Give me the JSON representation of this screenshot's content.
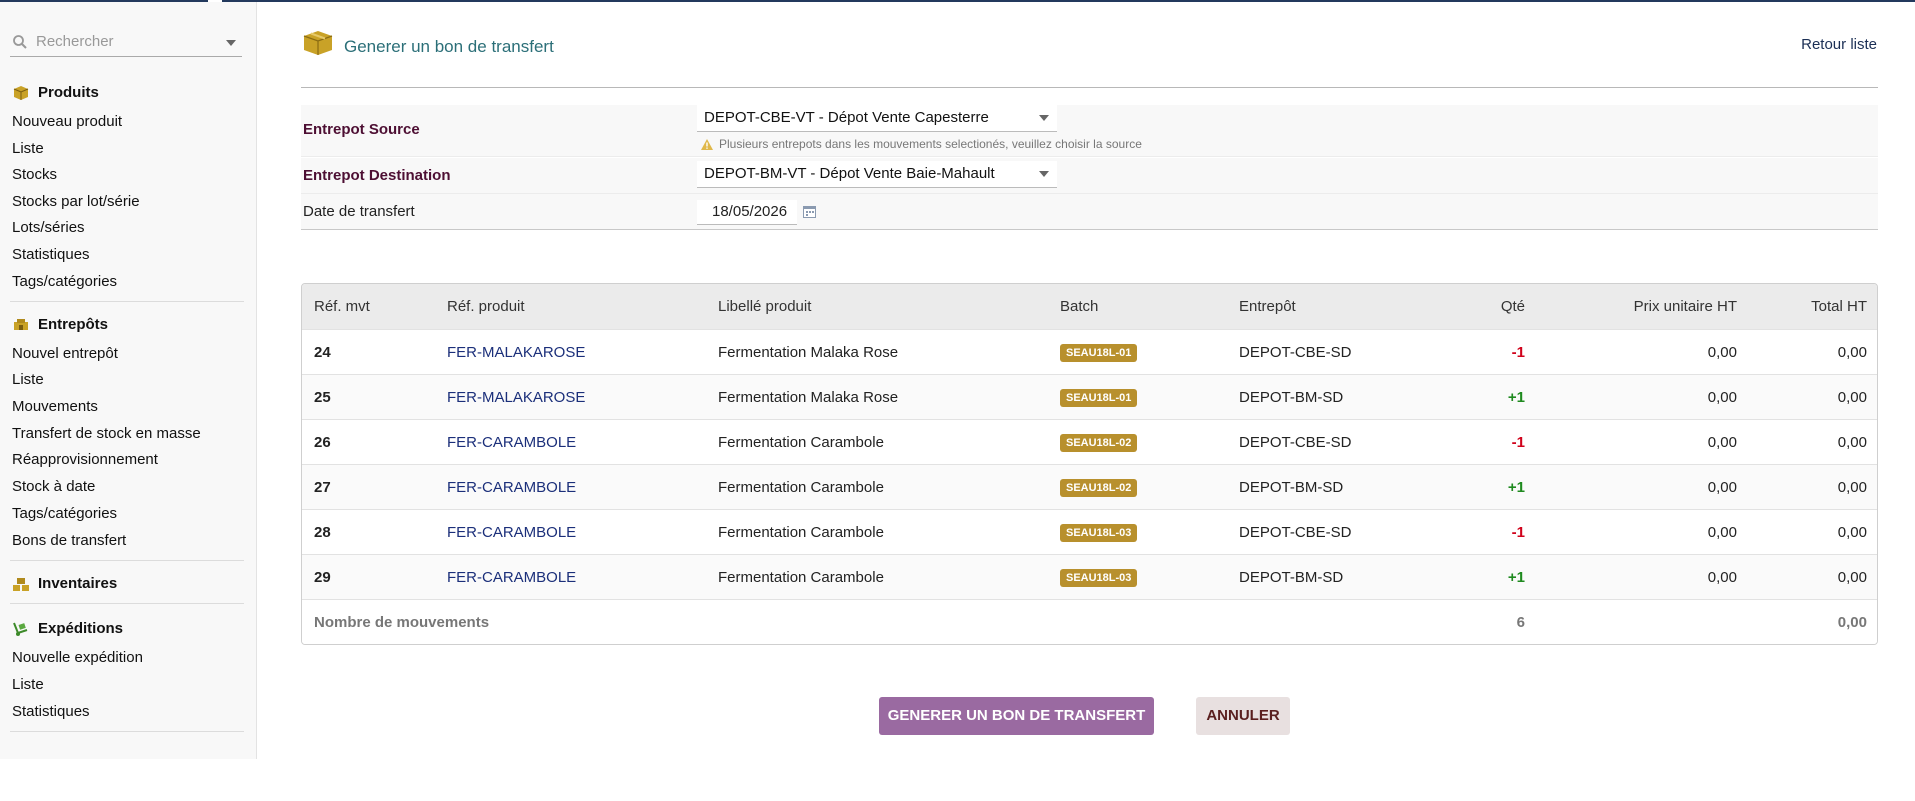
{
  "sidebar": {
    "search_placeholder": "Rechercher",
    "sections": [
      {
        "title": "Produits",
        "icon": "box-icon",
        "items": [
          "Nouveau produit",
          "Liste",
          "Stocks",
          "Stocks par lot/série",
          "Lots/séries",
          "Statistiques",
          "Tags/catégories"
        ]
      },
      {
        "title": "Entrepôts",
        "icon": "warehouse-icon",
        "items": [
          "Nouvel entrepôt",
          "Liste",
          "Mouvements",
          "Transfert de stock en masse",
          "Réapprovisionnement",
          "Stock à date",
          "Tags/catégories",
          "Bons de transfert"
        ]
      },
      {
        "title": "Inventaires",
        "icon": "inventory-icon",
        "items": []
      },
      {
        "title": "Expéditions",
        "icon": "dolly-icon",
        "items": [
          "Nouvelle expédition",
          "Liste",
          "Statistiques"
        ]
      }
    ]
  },
  "header": {
    "title": "Generer un bon de transfert",
    "back_link": "Retour liste"
  },
  "form": {
    "source_label": "Entrepot Source",
    "source_value": "DEPOT-CBE-VT - Dépot Vente Capesterre",
    "source_warning": "Plusieurs entrepots dans les mouvements selectionés, veuillez choisir la source",
    "dest_label": "Entrepot Destination",
    "dest_value": "DEPOT-BM-VT - Dépot Vente Baie-Mahault",
    "date_label": "Date de transfert",
    "date_value": "18/05/2026"
  },
  "table": {
    "headers": {
      "ref_mvt": "Réf. mvt",
      "ref_produit": "Réf. produit",
      "libelle": "Libellé produit",
      "batch": "Batch",
      "entrepot": "Entrepôt",
      "qte": "Qté",
      "prix": "Prix unitaire HT",
      "total": "Total HT"
    },
    "rows": [
      {
        "ref_mvt": "24",
        "ref_produit": "FER-MALAKAROSE",
        "libelle": "Fermentation Malaka Rose",
        "batch": "SEAU18L-01",
        "entrepot": "DEPOT-CBE-SD",
        "qte": "-1",
        "prix": "0,00",
        "total": "0,00"
      },
      {
        "ref_mvt": "25",
        "ref_produit": "FER-MALAKAROSE",
        "libelle": "Fermentation Malaka Rose",
        "batch": "SEAU18L-01",
        "entrepot": "DEPOT-BM-SD",
        "qte": "+1",
        "prix": "0,00",
        "total": "0,00"
      },
      {
        "ref_mvt": "26",
        "ref_produit": "FER-CARAMBOLE",
        "libelle": "Fermentation Carambole",
        "batch": "SEAU18L-02",
        "entrepot": "DEPOT-CBE-SD",
        "qte": "-1",
        "prix": "0,00",
        "total": "0,00"
      },
      {
        "ref_mvt": "27",
        "ref_produit": "FER-CARAMBOLE",
        "libelle": "Fermentation Carambole",
        "batch": "SEAU18L-02",
        "entrepot": "DEPOT-BM-SD",
        "qte": "+1",
        "prix": "0,00",
        "total": "0,00"
      },
      {
        "ref_mvt": "28",
        "ref_produit": "FER-CARAMBOLE",
        "libelle": "Fermentation Carambole",
        "batch": "SEAU18L-03",
        "entrepot": "DEPOT-CBE-SD",
        "qte": "-1",
        "prix": "0,00",
        "total": "0,00"
      },
      {
        "ref_mvt": "29",
        "ref_produit": "FER-CARAMBOLE",
        "libelle": "Fermentation Carambole",
        "batch": "SEAU18L-03",
        "entrepot": "DEPOT-BM-SD",
        "qte": "+1",
        "prix": "0,00",
        "total": "0,00"
      }
    ],
    "footer": {
      "label": "Nombre de mouvements",
      "count": "6",
      "total": "0,00"
    }
  },
  "actions": {
    "generate": "GENERER UN BON DE TRANSFERT",
    "cancel": "ANNULER"
  },
  "colors": {
    "primary_button": "#9a6aa1",
    "badge": "#b8902d",
    "negative": "#d0021b",
    "positive": "#1f8a1f",
    "title": "#2b6f78"
  }
}
